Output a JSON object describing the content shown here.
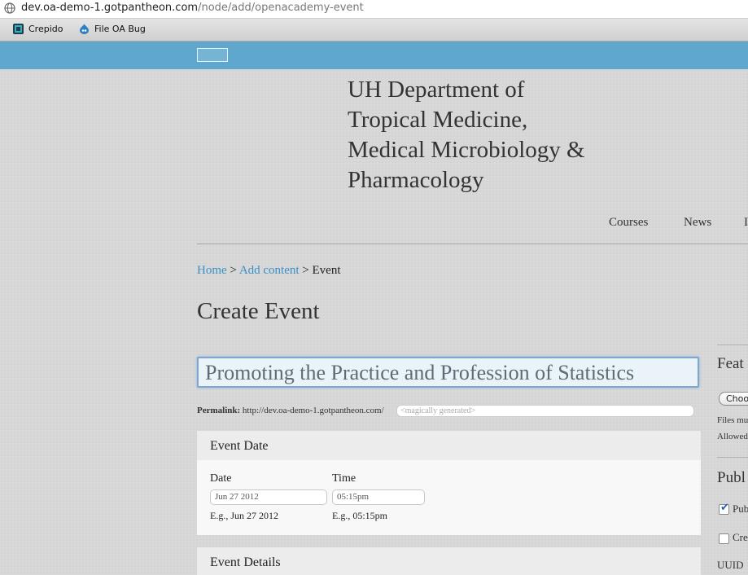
{
  "browser": {
    "url_host": "dev.oa-demo-1.gotpantheon.com",
    "url_path": "/node/add/openacademy-event",
    "bookmarks": [
      {
        "label": "Crepido",
        "icon": "crepido-icon"
      },
      {
        "label": "File OA Bug",
        "icon": "drupal-icon"
      }
    ]
  },
  "site": {
    "name": "UH Department of Tropical Medicine, Medical Microbiology & Pharmacology",
    "nav": [
      "Courses",
      "News",
      "I"
    ]
  },
  "breadcrumb": {
    "home": "Home",
    "sep1": " > ",
    "add_content": "Add content",
    "sep2": " > ",
    "current": "Event"
  },
  "page_title": "Create Event",
  "form": {
    "title_value": "Promoting the Practice and Profession of Statistics",
    "permalink_label": "Permalink:",
    "permalink_base": "http://dev.oa-demo-1.gotpantheon.com/",
    "permalink_placeholder": "<magically generated>",
    "event_date": {
      "heading": "Event Date",
      "date_label": "Date",
      "date_value": "Jun 27 2012",
      "date_hint": "E.g., Jun 27 2012",
      "time_label": "Time",
      "time_value": "05:15pm",
      "time_hint": "E.g., 05:15pm"
    },
    "event_details": {
      "heading": "Event Details"
    }
  },
  "sidebar": {
    "featured_heading": "Feat",
    "choose_label": "Choo",
    "files_note": "Files mu",
    "allowed_note": "Allowed",
    "publish_heading": "Publ",
    "published_label": "Pub",
    "published_checked": true,
    "create_label": "Cre",
    "create_checked": false,
    "uuid_label": "UUID"
  },
  "colors": {
    "bluebar": "#5fa7cd",
    "link": "#3a8fc4"
  }
}
